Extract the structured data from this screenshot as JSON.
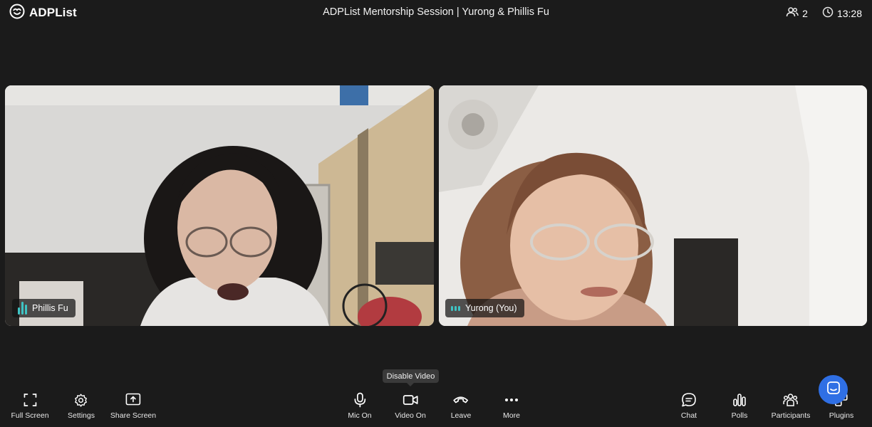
{
  "app": {
    "name": "ADPList"
  },
  "session": {
    "title": "ADPList Mentorship Session | Yurong & Phillis Fu"
  },
  "status": {
    "participant_count": "2",
    "time": "13:28"
  },
  "participants": [
    {
      "name": "Phillis Fu"
    },
    {
      "name": "Yurong (You)"
    }
  ],
  "tooltip": {
    "text": "Disable Video"
  },
  "toolbar": {
    "left": [
      {
        "label": "Full Screen",
        "icon": "fullscreen-icon"
      },
      {
        "label": "Settings",
        "icon": "gear-icon"
      },
      {
        "label": "Share Screen",
        "icon": "share-screen-icon"
      }
    ],
    "center": [
      {
        "label": "Mic On",
        "icon": "microphone-icon"
      },
      {
        "label": "Video On",
        "icon": "video-camera-icon"
      },
      {
        "label": "Leave",
        "icon": "phone-hangup-icon"
      },
      {
        "label": "More",
        "icon": "more-dots-icon"
      }
    ],
    "right": [
      {
        "label": "Chat",
        "icon": "chat-icon"
      },
      {
        "label": "Polls",
        "icon": "poll-icon"
      },
      {
        "label": "Participants",
        "icon": "participants-icon"
      },
      {
        "label": "Plugins",
        "icon": "plugins-icon"
      }
    ]
  },
  "colors": {
    "background": "#1b1b1b",
    "accent": "#2f6fe4",
    "audio_level": "#3ec4c4"
  }
}
